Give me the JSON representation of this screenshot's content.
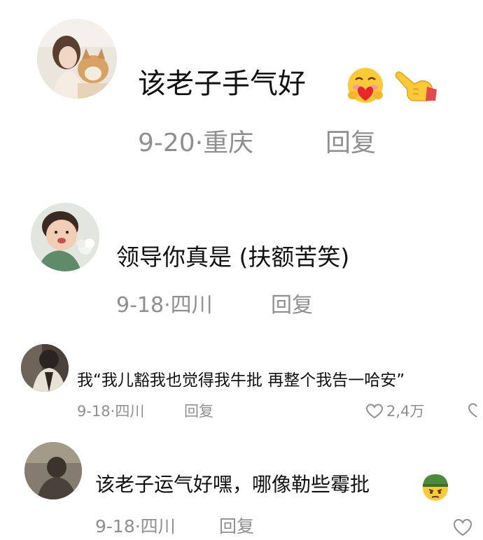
{
  "comments": [
    {
      "text": "该老子手气好",
      "date_location": "9-20·重庆",
      "reply_label": "回复",
      "emoji_icons": [
        "smiling-face-with-heart-icon",
        "pointing-hand-icon"
      ]
    },
    {
      "text": "领导你真是 (扶额苦笑)",
      "date_location": "9-18·四川",
      "reply_label": "回复"
    },
    {
      "text": "我“我儿豁我也觉得我牛批 再整个我告一哈安”",
      "date_location": "9-18·四川",
      "reply_label": "回复",
      "likes": "2,4万"
    },
    {
      "text": "该老子运气好嘿，哪像勒些霉批",
      "date_location": "9-18·四川",
      "reply_label": "回复",
      "emoji_icons": [
        "thinking-soldier-face-icon"
      ]
    }
  ]
}
